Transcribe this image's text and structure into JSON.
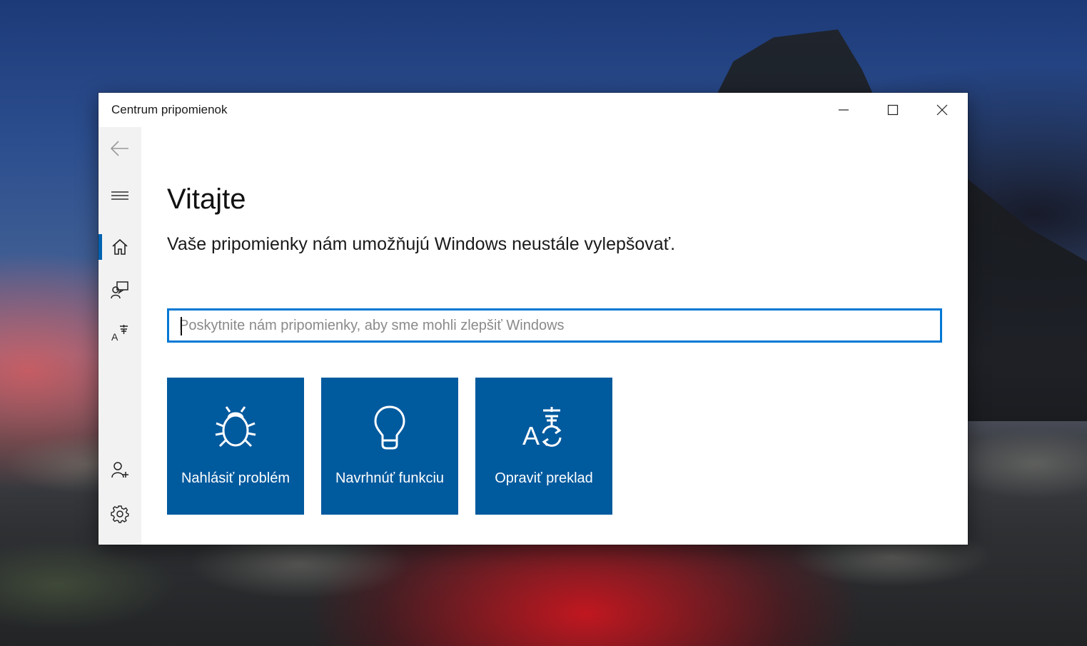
{
  "window": {
    "title": "Centrum pripomienok"
  },
  "sidebar": {
    "items": [
      {
        "name": "back",
        "icon": "back-arrow-icon"
      },
      {
        "name": "menu",
        "icon": "hamburger-icon"
      },
      {
        "name": "home",
        "icon": "home-icon",
        "selected": true
      },
      {
        "name": "feedback",
        "icon": "feedback-icon"
      },
      {
        "name": "translation",
        "icon": "translate-icon"
      },
      {
        "name": "account",
        "icon": "add-user-icon"
      },
      {
        "name": "settings",
        "icon": "gear-icon"
      }
    ],
    "accent_color": "#0063b1"
  },
  "main": {
    "heading": "Vitajte",
    "subtitle": "Vaše pripomienky nám umožňujú Windows neustále vylepšovať.",
    "search": {
      "placeholder": "Poskytnite nám pripomienky, aby sme mohli zlepšiť Windows",
      "value": ""
    },
    "tiles": [
      {
        "label": "Nahlásiť problém",
        "icon": "bug-icon"
      },
      {
        "label": "Navrhnúť funkciu",
        "icon": "lightbulb-icon"
      },
      {
        "label": "Opraviť preklad",
        "icon": "translate-icon"
      }
    ],
    "tile_color": "#005a9e",
    "focus_color": "#0078d4"
  }
}
